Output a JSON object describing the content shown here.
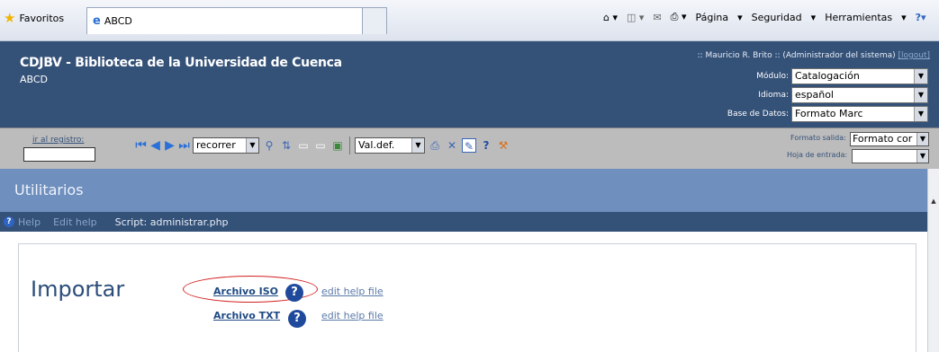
{
  "browser": {
    "favorites_label": "Favoritos",
    "tab_label": "ABCD",
    "commands": [
      "Página",
      "Seguridad",
      "Herramientas"
    ]
  },
  "header": {
    "title": "CDJBV - Biblioteca de la Universidad de Cuenca",
    "subtitle": "ABCD",
    "user": ":: Mauricio R. Brito :: (Administrador del sistema)",
    "logout": "[logout]",
    "modulo_label": "Módulo:",
    "modulo_value": "Catalogación",
    "idioma_label": "Idioma:",
    "idioma_value": "español",
    "base_label": "Base de Datos:",
    "base_value": "Formato Marc"
  },
  "toolbar": {
    "ir_registro_label": "ir al registro:",
    "recorrer_value": "recorrer",
    "valdef_value": "Val.def.",
    "formato_salida_label": "Formato salida:",
    "formato_salida_value": "Formato cor",
    "hoja_entrada_label": "Hoja de entrada:",
    "hoja_entrada_value": ""
  },
  "section": {
    "title": "Utilitarios",
    "help": "Help",
    "edit_help": "Edit help",
    "script": "Script: administrar.php"
  },
  "content": {
    "heading": "Importar",
    "items": [
      {
        "label": "Archivo ISO",
        "edit": "edit help file"
      },
      {
        "label": "Archivo TXT",
        "edit": "edit help file"
      }
    ]
  },
  "colors": {
    "header_bg": "#345178",
    "section_bg": "#6f8fbe",
    "annotation": "#d42020"
  }
}
